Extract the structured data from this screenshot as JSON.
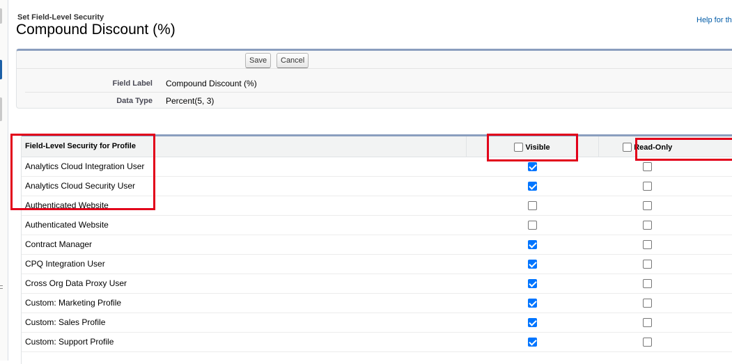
{
  "header": {
    "subtitle": "Set Field-Level Security",
    "title": "Compound Discount (%)",
    "help_link": "Help for thi"
  },
  "toolbar": {
    "save_label": "Save",
    "cancel_label": "Cancel"
  },
  "field_details": {
    "field_label_key": "Field Label",
    "field_label_value": "Compound Discount (%)",
    "data_type_key": "Data Type",
    "data_type_value": "Percent(5, 3)"
  },
  "fls_table": {
    "header_profile": "Field-Level Security for Profile",
    "header_visible": "Visible",
    "header_read_only": "Read-Only",
    "header_visible_checked": false,
    "header_read_only_checked": false,
    "rows": [
      {
        "profile": "Analytics Cloud Integration User",
        "visible": true,
        "read_only": false
      },
      {
        "profile": "Analytics Cloud Security User",
        "visible": true,
        "read_only": false
      },
      {
        "profile": "Authenticated Website",
        "visible": false,
        "read_only": false
      },
      {
        "profile": "Authenticated Website",
        "visible": false,
        "read_only": false
      },
      {
        "profile": "Contract Manager",
        "visible": true,
        "read_only": false
      },
      {
        "profile": "CPQ Integration User",
        "visible": true,
        "read_only": false
      },
      {
        "profile": "Cross Org Data Proxy User",
        "visible": true,
        "read_only": false
      },
      {
        "profile": "Custom: Marketing Profile",
        "visible": true,
        "read_only": false
      },
      {
        "profile": "Custom: Sales Profile",
        "visible": true,
        "read_only": false
      },
      {
        "profile": "Custom: Support Profile",
        "visible": true,
        "read_only": false
      }
    ]
  },
  "colors": {
    "highlight": "#e2001a",
    "section_border": "#8a9ebe",
    "checkbox_checked": "#0075ff",
    "link": "#015ba7"
  }
}
